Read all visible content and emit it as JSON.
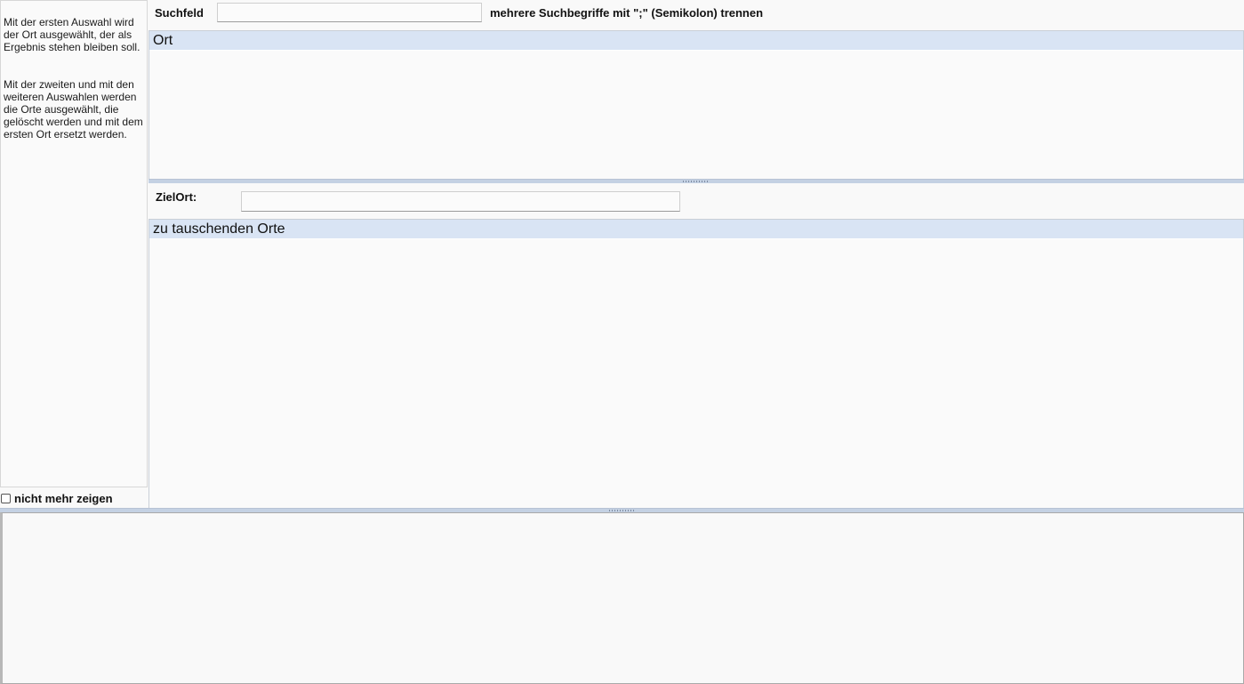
{
  "help": {
    "paragraph1": "Mit der ersten Auswahl wird der Ort ausgewählt, der als Ergebnis stehen bleiben soll.",
    "paragraph2": "Mit der zweiten und mit den weiteren Auswahlen werden die Orte ausgewählt, die gelöscht werden und mit dem ersten Ort ersetzt werden.",
    "no_show_label": "nicht mehr zeigen",
    "no_show_checked": false
  },
  "search": {
    "label": "Suchfeld",
    "value": "",
    "hint": "mehrere Suchbegriffe mit \";\" (Semikolon) trennen"
  },
  "ort_list": {
    "header": "Ort",
    "items": []
  },
  "ziel": {
    "label": "ZielOrt:",
    "value": ""
  },
  "tausch_list": {
    "header": "zu tauschenden Orte",
    "items": []
  },
  "colors": {
    "header_bg": "#d9e4f4",
    "splitter": "#c4d1e3",
    "panel_bg": "#fafafa"
  }
}
